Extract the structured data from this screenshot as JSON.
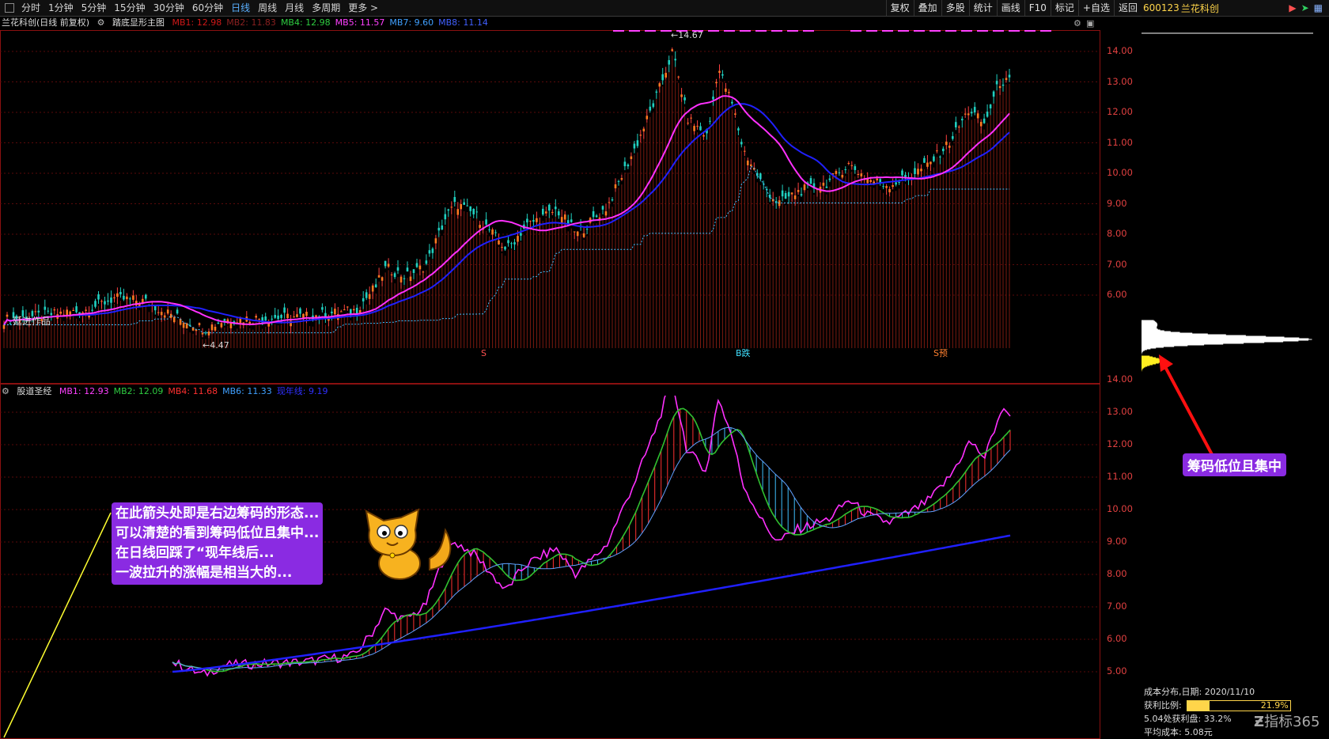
{
  "toolbar": {
    "periods": [
      "分时",
      "1分钟",
      "5分钟",
      "15分钟",
      "30分钟",
      "60分钟",
      "日线",
      "周线",
      "月线",
      "多周期",
      "更多 >"
    ],
    "active_period": "日线",
    "right_buttons": [
      "复权",
      "叠加",
      "多股",
      "统计",
      "画线",
      "F10",
      "标记",
      "+自选",
      "返回"
    ]
  },
  "stock": {
    "code": "600123",
    "name": "兰花科创"
  },
  "main_panel": {
    "title": "兰花科创(日线 前复权)",
    "indicator": "踏底显形主图",
    "mas": [
      {
        "label": "MB1: 12.98",
        "color": "#d01818"
      },
      {
        "label": "MB2: 11.83",
        "color": "#8a2020"
      },
      {
        "label": "MB4: 12.98",
        "color": "#2ecc40"
      },
      {
        "label": "MB5: 11.57",
        "color": "#ff40ff"
      },
      {
        "label": "MB7: 9.60",
        "color": "#40a0ff"
      },
      {
        "label": "MB8: 11.14",
        "color": "#4060ff"
      }
    ],
    "high_label": "14.67",
    "low_label": "4.47",
    "watermark": "延进作品",
    "markers": [
      "S",
      "B跌",
      "S预"
    ],
    "ticks": [
      14.0,
      13.0,
      12.0,
      11.0,
      10.0,
      9.0,
      8.0,
      7.0,
      6.0
    ]
  },
  "sub_panel": {
    "indicator": "股道圣经",
    "mas": [
      {
        "label": "MB1: 12.93",
        "color": "#ff40ff"
      },
      {
        "label": "MB2: 12.09",
        "color": "#2ecc40"
      },
      {
        "label": "MB4: 11.68",
        "color": "#ff3030"
      },
      {
        "label": "MB6: 11.33",
        "color": "#40a0ff"
      },
      {
        "label": "现年线: 9.19",
        "color": "#3030ff"
      }
    ],
    "ticks": [
      14.0,
      13.0,
      12.0,
      11.0,
      10.0,
      9.0,
      8.0,
      7.0,
      6.0,
      5.0
    ]
  },
  "annotation": {
    "lines": [
      "在此箭头处即是右边筹码的形态...",
      "可以清楚的看到筹码低位且集中...",
      "在日线回踩了“现年线后...",
      "一波拉升的涨幅是相当大的..."
    ],
    "callout": "筹码低位且集中"
  },
  "chip_info": {
    "title": "成本分布,日期:",
    "date": "2020/11/10",
    "profit_label": "获利比例:",
    "profit_pct": "21.9%",
    "profit_value": 0.219,
    "line2": "5.04处获利盘:",
    "line2_val": "33.2%",
    "avg_label": "平均成本:",
    "avg_val": "5.08元"
  },
  "watermark": "指标365",
  "colors": {
    "axis_red": "#e04040",
    "grid": "#6a0a0a",
    "yellow": "#ffd54a",
    "bubble": "#8a2be2"
  }
}
